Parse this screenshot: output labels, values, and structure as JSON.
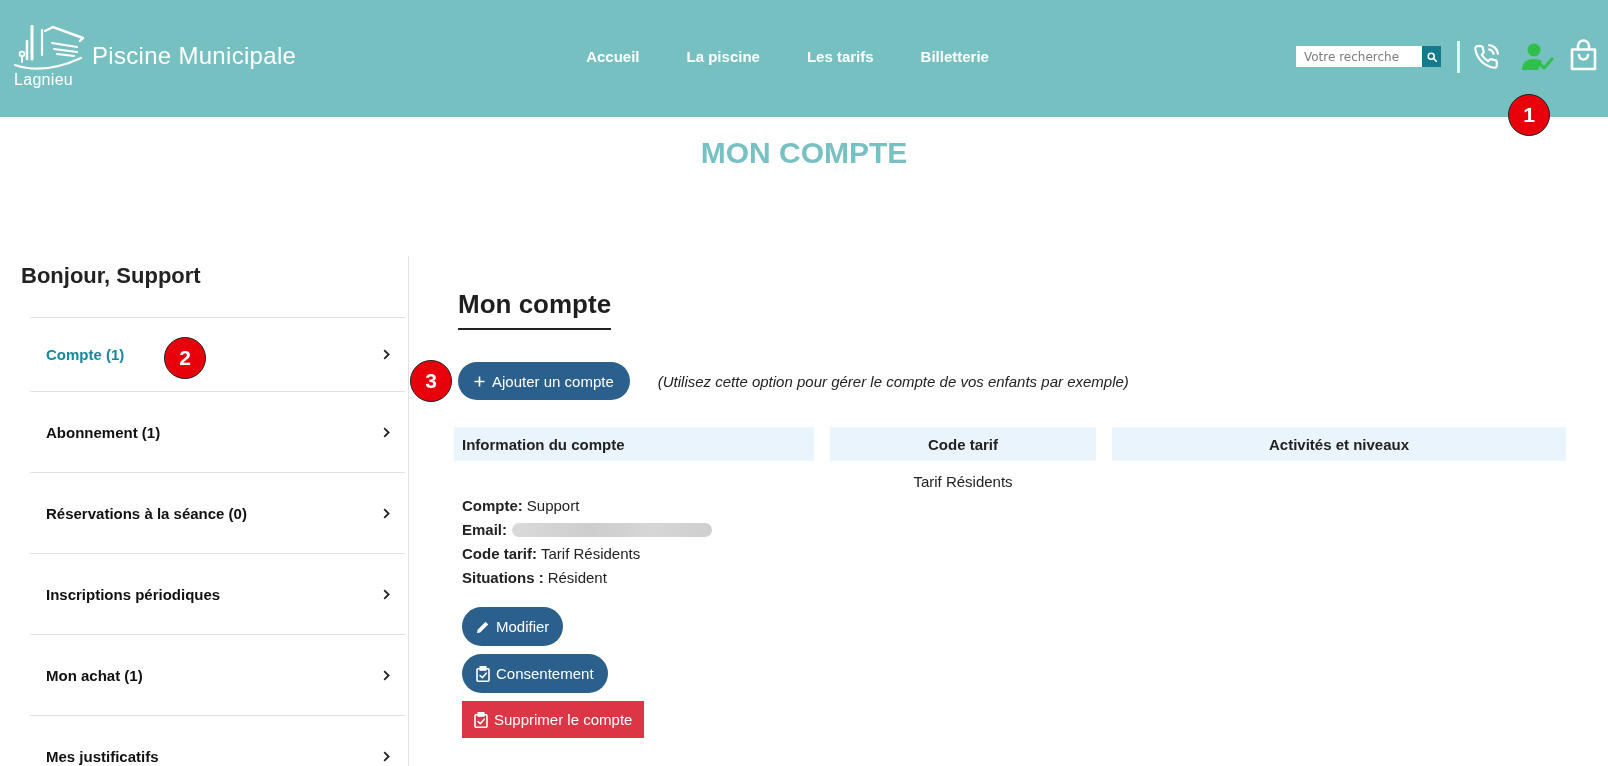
{
  "header": {
    "logo_text": "Lagnieu",
    "site_title": "Piscine Municipale",
    "nav": [
      {
        "label": "Accueil"
      },
      {
        "label": "La piscine"
      },
      {
        "label": "Les tarifs"
      },
      {
        "label": "Billetterie"
      }
    ],
    "search": {
      "placeholder": "Votre recherche"
    },
    "user_logged_in": true
  },
  "page_title": "MON COMPTE",
  "sidebar": {
    "greeting": "Bonjour, Support",
    "items": [
      {
        "label": "Compte (1)",
        "selected": true
      },
      {
        "label": "Abonnement (1)",
        "selected": false
      },
      {
        "label": "Réservations à la séance (0)",
        "selected": false
      },
      {
        "label": "Inscriptions périodiques",
        "selected": false
      },
      {
        "label": "Mon achat (1)",
        "selected": false
      },
      {
        "label": "Mes justificatifs",
        "selected": false
      }
    ]
  },
  "main": {
    "heading": "Mon compte",
    "add_button": "Ajouter un compte",
    "add_note": "(Utilisez cette option pour gérer le compte de vos enfants par exemple)",
    "table": {
      "columns": [
        "Information du compte",
        "Code tarif",
        "Activités et niveaux"
      ],
      "rows": [
        {
          "tariff": "Tarif Résidents",
          "details": [
            {
              "label": "Compte:",
              "value": "Support",
              "redacted": false
            },
            {
              "label": "Email:",
              "redacted": true
            },
            {
              "label": "Code tarif:",
              "value": "Tarif Résidents",
              "redacted": false
            },
            {
              "label": "Situations :",
              "value": "Résident",
              "redacted": false
            }
          ],
          "actions": [
            {
              "label": "Modifier",
              "kind": "edit"
            },
            {
              "label": "Consentement",
              "kind": "consent"
            },
            {
              "label": "Supprimer le compte",
              "kind": "delete"
            }
          ]
        }
      ]
    }
  },
  "annotations": [
    {
      "label": "1"
    },
    {
      "label": "2"
    },
    {
      "label": "3"
    }
  ]
}
